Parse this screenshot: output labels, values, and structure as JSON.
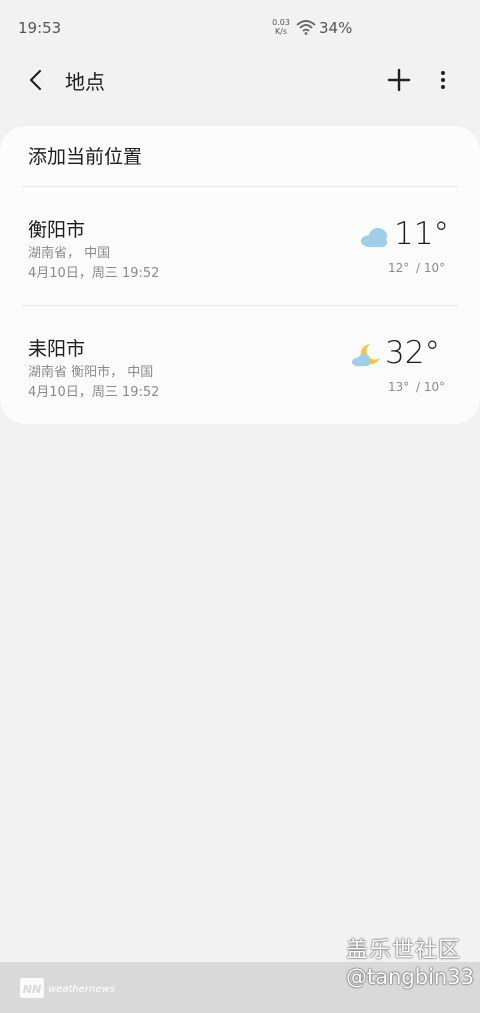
{
  "status_bar": {
    "time": "19:53",
    "speed_value": "0.03",
    "speed_unit": "K/s",
    "battery": "34%"
  },
  "header": {
    "title": "地点",
    "back_icon": "back-arrow-icon",
    "add_icon": "plus-icon",
    "more_icon": "more-vertical-icon"
  },
  "card": {
    "add_current_location": "添加当前位置"
  },
  "locations": [
    {
      "name": "衡阳市",
      "region": "湖南省， 中国",
      "updated": "4月10日，周三 19:52",
      "weather_icon": "cloud-icon",
      "temp": "11°",
      "hi": "12°",
      "lo": "/ 10°"
    },
    {
      "name": "耒阳市",
      "region": "湖南省 衡阳市， 中国",
      "updated": "4月10日，周三 19:52",
      "weather_icon": "moon-cloud-icon",
      "temp": "32°",
      "hi": "13°",
      "lo": "/ 10°"
    }
  ],
  "footer": {
    "provider": "weathernews",
    "provider_logo": "NN"
  },
  "watermark": {
    "title": "盖乐世社区",
    "user": "@tangbin33"
  },
  "colors": {
    "background": "#f2f2f2",
    "card": "#fcfcfc",
    "cloud": "#9fcfe8",
    "moon": "#f4c542"
  }
}
